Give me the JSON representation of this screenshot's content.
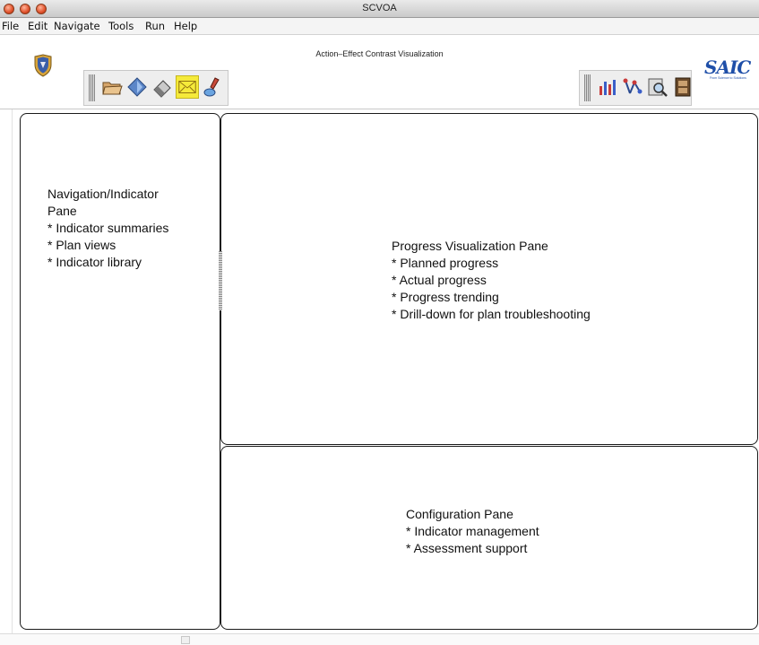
{
  "window": {
    "title": "SCVOA"
  },
  "menubar": {
    "items": [
      "File",
      "Edit",
      "Navigate",
      "Tools",
      "Run",
      "Help"
    ]
  },
  "toolbar": {
    "title": "Action–Effect Contrast Visualization",
    "left_tools": [
      "folder-open-icon",
      "diamond-icon",
      "eraser-icon",
      "envelope-icon",
      "brush-icon"
    ],
    "right_tools": [
      "bar-chart-icon",
      "network-icon",
      "magnifier-icon",
      "cabinet-icon"
    ],
    "highlight_color": "#f5ea3a"
  },
  "brand": {
    "name": "SAIC",
    "tagline": "From Science to Solutions",
    "color": "#1f4fa8"
  },
  "panes": {
    "navigation": {
      "lines": [
        "Navigation/Indicator",
        "Pane",
        "* Indicator summaries",
        "* Plan views",
        "* Indicator library"
      ]
    },
    "progress": {
      "lines": [
        "Progress Visualization Pane",
        "* Planned progress",
        "* Actual progress",
        "* Progress trending",
        "* Drill-down for plan troubleshooting"
      ]
    },
    "configuration": {
      "lines": [
        "Configuration Pane",
        "* Indicator management",
        "* Assessment support"
      ]
    }
  }
}
